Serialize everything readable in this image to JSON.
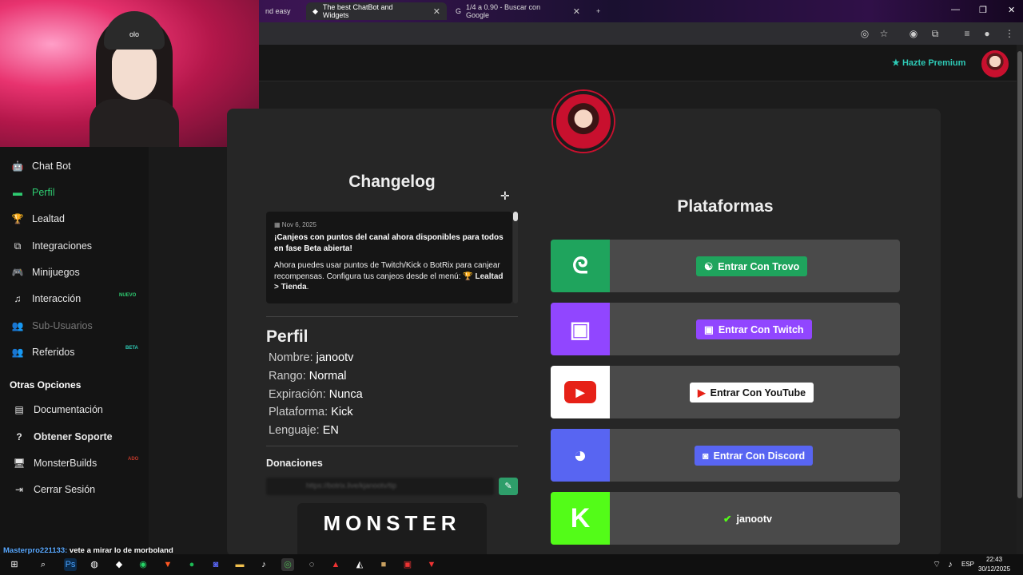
{
  "browser": {
    "tabs": [
      {
        "title": "nd easy",
        "active": false
      },
      {
        "title": "The best ChatBot and Widgets",
        "active": true
      },
      {
        "title": "1/4 a 0.90 - Buscar con Google",
        "active": false
      }
    ],
    "new_tab": "+"
  },
  "header": {
    "premium_label": "Hazte Premium"
  },
  "webcam": {
    "beanie_text": "olo"
  },
  "sidebar": {
    "items": [
      {
        "label": "Chat Bot",
        "icon": "robot-icon",
        "glyph": "🤖"
      },
      {
        "label": "Perfil",
        "icon": "id-card-icon",
        "glyph": "▬"
      },
      {
        "label": "Lealtad",
        "icon": "trophy-icon",
        "glyph": "🏆"
      },
      {
        "label": "Integraciones",
        "icon": "integration-icon",
        "glyph": "⧉"
      },
      {
        "label": "Minijuegos",
        "icon": "gamepad-icon",
        "glyph": "🎮"
      },
      {
        "label": "Interacción",
        "icon": "music-icon",
        "glyph": "♫"
      },
      {
        "label": "Sub-Usuarios",
        "icon": "users-icon",
        "glyph": "👥"
      },
      {
        "label": "Referidos",
        "icon": "referral-icon",
        "glyph": "👥"
      }
    ],
    "badges": {
      "nuevo": "NUEVO",
      "beta": "BETA",
      "ad": "ADO"
    },
    "section_title": "Otras Opciones",
    "other_items": [
      {
        "label": "Documentación",
        "icon": "docs-icon",
        "glyph": "▤"
      },
      {
        "label": "Obtener Soporte",
        "icon": "help-icon",
        "glyph": "?"
      },
      {
        "label": "MonsterBuilds",
        "icon": "monitor-icon",
        "glyph": "🖥"
      },
      {
        "label": "Cerrar Sesión",
        "icon": "logout-icon",
        "glyph": "⇥"
      }
    ]
  },
  "changelog": {
    "title": "Changelog",
    "date": "Nov 6, 2025",
    "headline": "¡Canjeos con puntos del canal ahora disponibles para todos en fase Beta abierta!",
    "body": "Ahora puedes usar puntos de Twitch/Kick o BotRix para canjear recompensas. Configura tus canjeos desde el menú:",
    "path": "Lealtad > Tienda",
    "end": "."
  },
  "profile": {
    "title": "Perfil",
    "rows": [
      {
        "label": "Nombre:",
        "value": "janootv"
      },
      {
        "label": "Rango:",
        "value": "Normal"
      },
      {
        "label": "Expiración:",
        "value": "Nunca"
      },
      {
        "label": "Plataforma:",
        "value": "Kick"
      },
      {
        "label": "Lenguaje:",
        "value": "EN"
      }
    ],
    "donations_label": "Donaciones",
    "donations_url": "https://botrix.live/kjanootv/tip",
    "logo_text": "MONSTER"
  },
  "platforms": {
    "title": "Plataformas",
    "items": [
      {
        "name": "trovo",
        "button": "Entrar Con Trovo",
        "color": "#1fa45d",
        "btn_color": "#1fa45d"
      },
      {
        "name": "twitch",
        "button": "Entrar Con Twitch",
        "color": "#9146ff",
        "btn_color": "#9146ff"
      },
      {
        "name": "youtube",
        "button": "Entrar Con YouTube",
        "color": "#ffffff",
        "btn_color": "#ffffff"
      },
      {
        "name": "discord",
        "button": "Entrar Con Discord",
        "color": "#5865f2",
        "btn_color": "#5865f2"
      },
      {
        "name": "kick",
        "button": "janootv",
        "color": "#53fc18",
        "btn_color": "transparent"
      }
    ]
  },
  "chat": {
    "user": "Masterpro221133:",
    "message": "vete a mirar lo de morboland"
  },
  "taskbar": {
    "lang": "ESP",
    "time": "22:43",
    "date": "30/12/2025"
  }
}
